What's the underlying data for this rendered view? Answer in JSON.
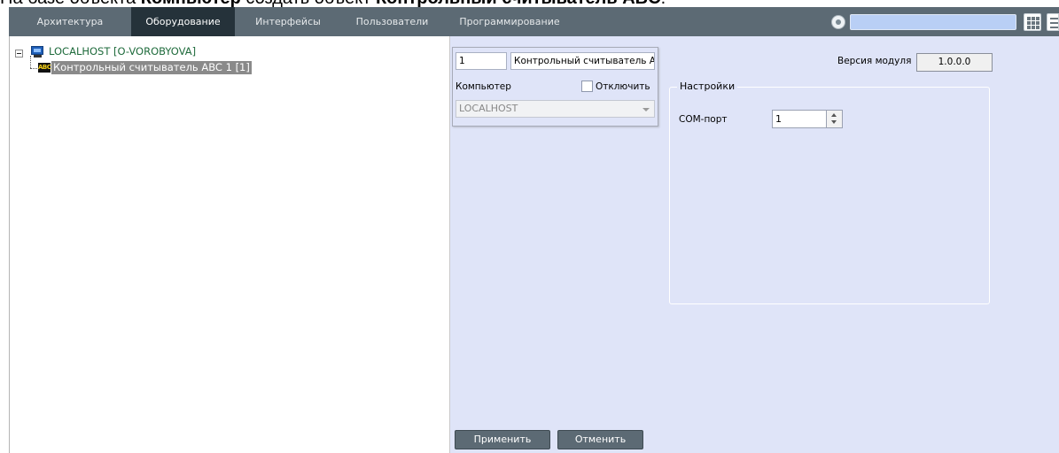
{
  "caption": {
    "prefix": "На базе объекта ",
    "bold1": "Компьютер",
    "middle": " создать объект ",
    "bold2": "Контрольный считыватель ABC",
    "suffix": "."
  },
  "topbar": {
    "tabs": [
      {
        "label": "Архитектура",
        "active": false
      },
      {
        "label": "Оборудование",
        "active": true
      },
      {
        "label": "Интерфейсы",
        "active": false
      },
      {
        "label": "Пользователи",
        "active": false
      },
      {
        "label": "Программирование",
        "active": false
      }
    ],
    "search_value": "",
    "search_color": "#b9cff5",
    "bar_color": "#5c6a74",
    "active_tab_color": "#25323a"
  },
  "tree": {
    "host": {
      "label": "LOCALHOST [O-VOROBYOVA]",
      "icon": "computer-icon"
    },
    "reader": {
      "label": "Контрольный считыватель ABC 1 [1]",
      "icon": "abc-reader-icon",
      "icon_text": "ABC",
      "selected": true
    }
  },
  "object": {
    "id": "1",
    "name": "Контрольный считыватель A",
    "computer_label": "Компьютер",
    "disable_label": "Отключить",
    "disable_checked": false,
    "computer_value": "LOCALHOST"
  },
  "module_version": {
    "label": "Версия модуля",
    "value": "1.0.0.0"
  },
  "settings": {
    "title": "Настройки",
    "com_port_label": "COM-порт",
    "com_port_value": "1"
  },
  "actions": {
    "apply": "Применить",
    "cancel": "Отменить"
  }
}
